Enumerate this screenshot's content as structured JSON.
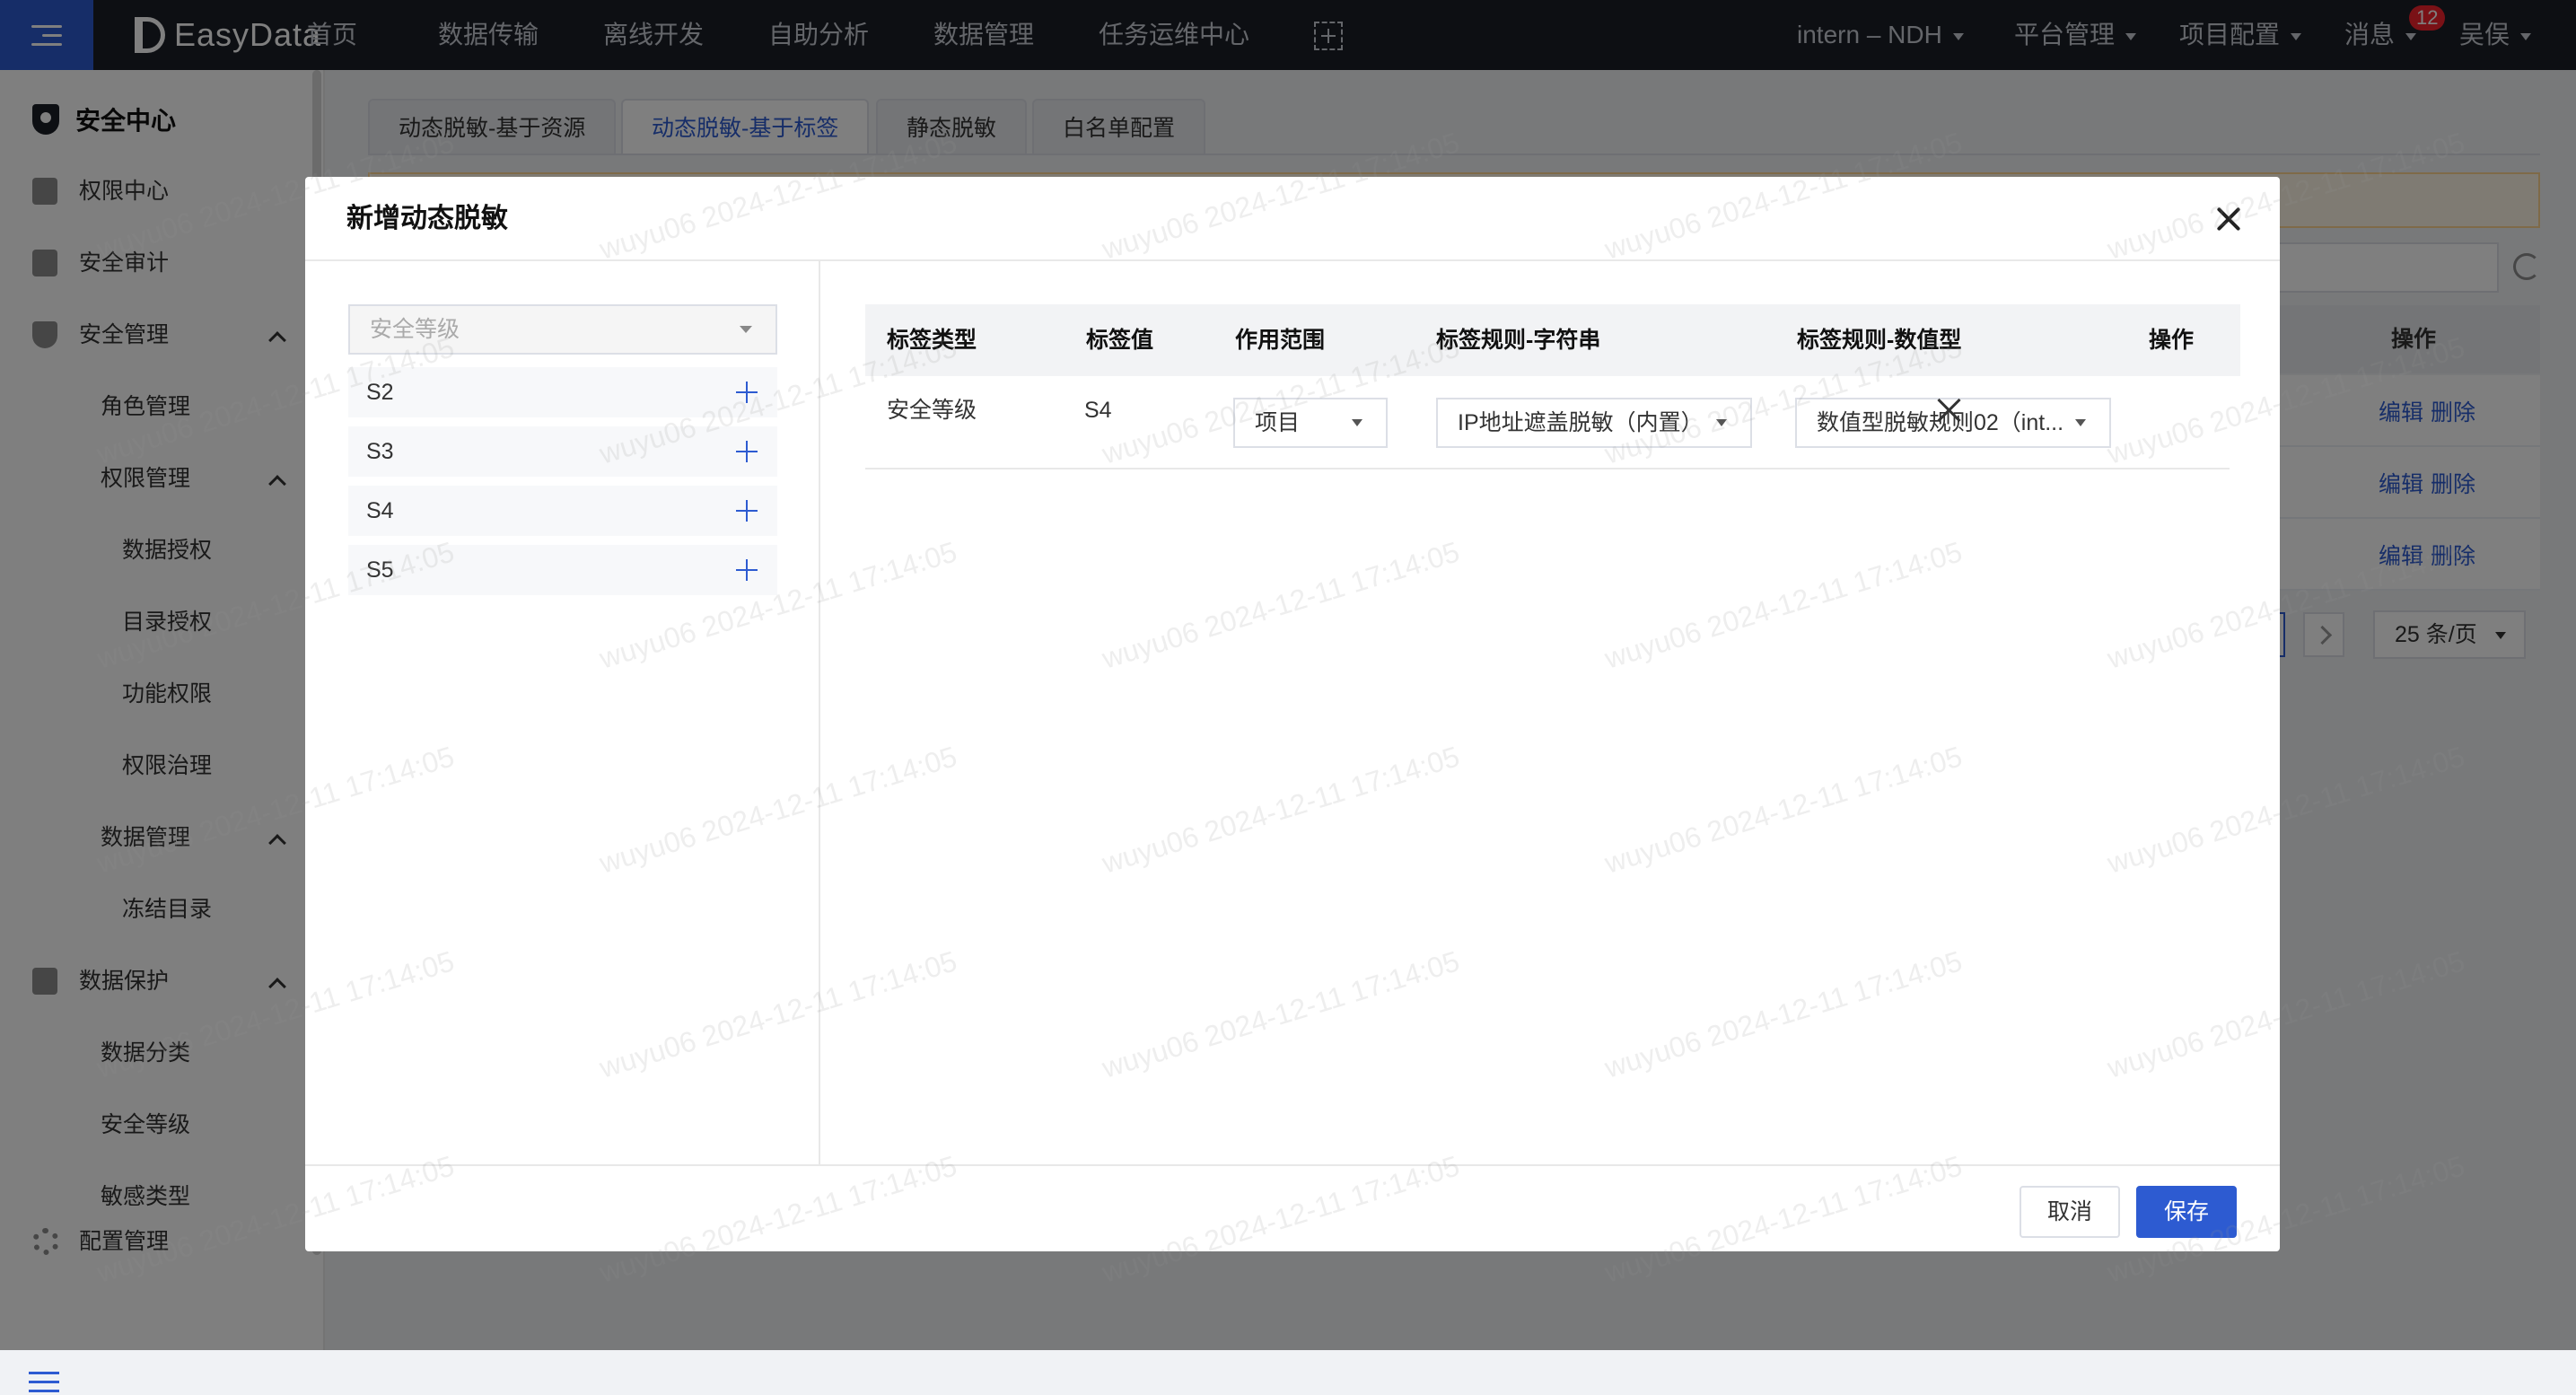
{
  "topnav": {
    "brand": "EasyData",
    "items": [
      "首页",
      "数据传输",
      "离线开发",
      "自助分析",
      "数据管理",
      "任务运维中心"
    ],
    "right": [
      {
        "label": "intern – NDH"
      },
      {
        "label": "平台管理"
      },
      {
        "label": "项目配置"
      },
      {
        "label": "消息",
        "badge": "12"
      },
      {
        "label": "吴俣"
      }
    ]
  },
  "sidebar": {
    "title": "安全中心",
    "items": [
      {
        "label": "权限中心"
      },
      {
        "label": "安全审计"
      },
      {
        "label": "安全管理"
      },
      {
        "label": "角色管理"
      },
      {
        "label": "权限管理"
      },
      {
        "label": "数据授权"
      },
      {
        "label": "目录授权"
      },
      {
        "label": "功能权限"
      },
      {
        "label": "权限治理"
      },
      {
        "label": "数据管理"
      },
      {
        "label": "冻结目录"
      },
      {
        "label": "数据保护"
      },
      {
        "label": "数据分类"
      },
      {
        "label": "安全等级"
      },
      {
        "label": "敏感类型"
      },
      {
        "label": "配置管理"
      }
    ]
  },
  "page": {
    "tabs": [
      {
        "label": "动态脱敏-基于资源"
      },
      {
        "label": "动态脱敏-基于标签"
      },
      {
        "label": "静态脱敏"
      },
      {
        "label": "白名单配置"
      }
    ],
    "table_op_header": "操作",
    "row_actions": {
      "edit": "编辑",
      "delete": "删除"
    },
    "pager": {
      "page_size": "25 条/页"
    }
  },
  "modal": {
    "title": "新增动态脱敏",
    "tag_type_select": {
      "value": "安全等级"
    },
    "tag_values": [
      "S2",
      "S3",
      "S4",
      "S5"
    ],
    "columns": [
      "标签类型",
      "标签值",
      "作用范围",
      "标签规则-字符串",
      "标签规则-数值型",
      "操作"
    ],
    "rows": [
      {
        "tag_type": "安全等级",
        "tag_value": "S4",
        "scope": "项目",
        "string_rule": "IP地址遮盖脱敏（内置）",
        "numeric_rule": "数值型脱敏规则02（int..."
      }
    ],
    "buttons": {
      "cancel": "取消",
      "save": "保存"
    }
  },
  "watermark": "wuyu06 2024-12-11 17:14:05",
  "colors": {
    "accent": "#2d5bd1",
    "topbar": "#1b1f27",
    "notice_bg": "#fff7e6",
    "badge": "#f5222d"
  }
}
